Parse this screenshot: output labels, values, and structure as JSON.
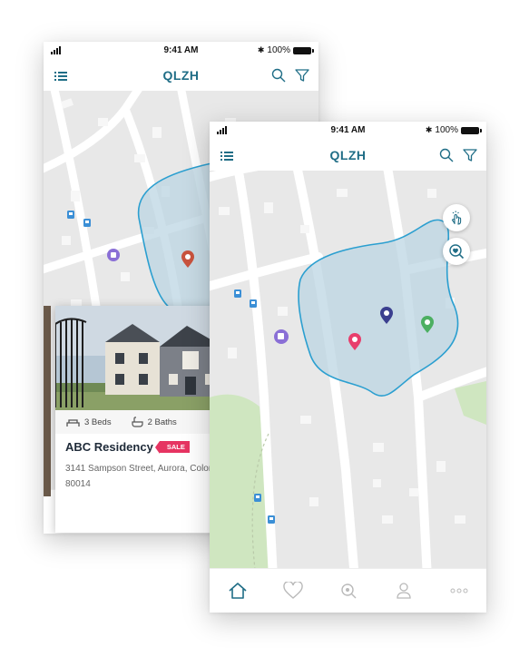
{
  "screens": {
    "back": {
      "status": {
        "time": "9:41 AM",
        "battery": "100%"
      },
      "nav": {
        "title": "QLZH"
      },
      "property_card": {
        "beds": "3 Beds",
        "baths": "2 Baths",
        "name": "ABC Residency",
        "badge": "SALE",
        "address": "3141 Sampson Street, Aurora, Colorado - 80014"
      }
    },
    "front": {
      "status": {
        "time": "9:41 AM",
        "battery": "100%"
      },
      "nav": {
        "title": "QLZH"
      }
    }
  },
  "colors": {
    "brand": "#1f6d86",
    "region_fill": "#bcd6e3",
    "region_stroke": "#2b9fd0",
    "pin_red": "#c9533e",
    "pin_navy": "#3b3f8f",
    "pin_pink": "#e83e6c",
    "pin_green": "#4caf61",
    "sale_badge": "#e63462"
  },
  "icons": {
    "nav_left": "menu-list-icon",
    "nav_right": [
      "search-icon",
      "filter-icon"
    ],
    "map_fabs": [
      "draw-gesture-icon",
      "saved-search-icon"
    ],
    "tabs": [
      "home-icon",
      "heart-icon",
      "search-pin-icon",
      "user-icon",
      "more-icon"
    ]
  }
}
